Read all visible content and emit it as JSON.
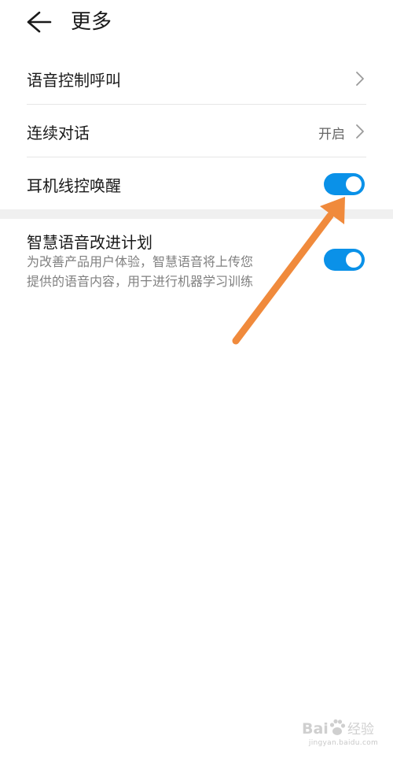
{
  "header": {
    "title": "更多",
    "back_icon": "arrow-left-icon"
  },
  "settings": [
    {
      "label": "语音控制呼叫",
      "control": "chevron-right-icon"
    },
    {
      "label": "连续对话",
      "value": "开启",
      "control": "chevron-right-icon"
    },
    {
      "label": "耳机线控唤醒",
      "control": "toggle",
      "enabled": true
    },
    {
      "label": "智慧语音改进计划",
      "description_line1": "为改善产品用户体验，智慧语音将上传您",
      "description_line2": "提供的语音内容，用于进行机器学习训练",
      "control": "toggle",
      "enabled": true
    }
  ],
  "colors": {
    "toggle_on": "#0a91e8",
    "annotation_arrow": "#f08a3c",
    "divider": "#e6e6e6",
    "section_gap": "#f0f0f0"
  },
  "watermark": {
    "logo_text": "Bai 经验",
    "url": "jingyan.baidu.com"
  }
}
